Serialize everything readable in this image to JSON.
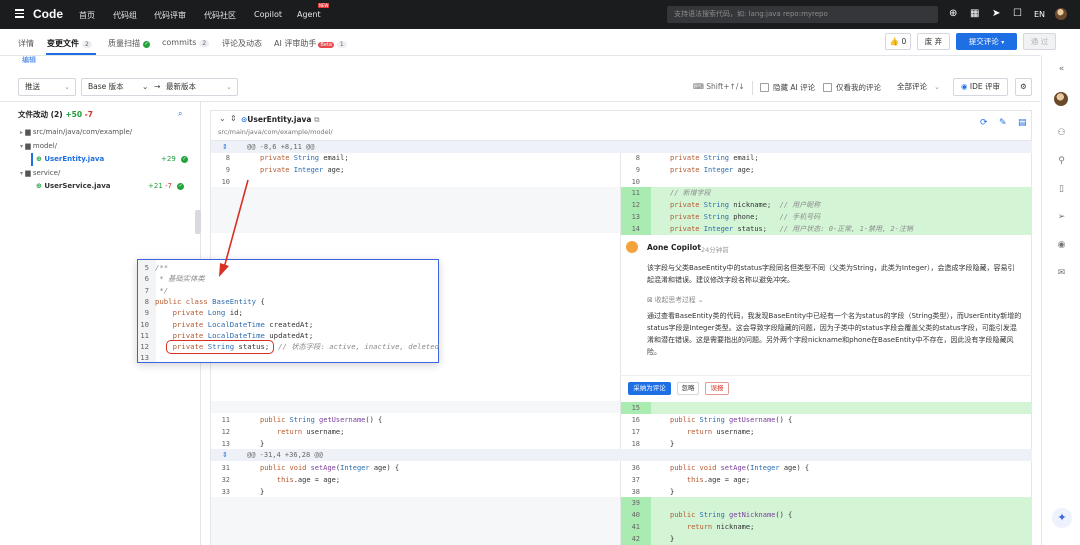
{
  "topbar": {
    "logo": "Code",
    "nav": [
      "首页",
      "代码组",
      "代码评审",
      "代码社区",
      "Copilot",
      "Agent"
    ],
    "new_badge": "NEW",
    "search_placeholder": "支持语法搜索代码，如: lang:java repo:myrepo",
    "lang": "EN"
  },
  "tabs": [
    {
      "label": "详情"
    },
    {
      "label": "变更文件",
      "count": "2"
    },
    {
      "label": "质量扫描"
    },
    {
      "label": "commits",
      "count": "2"
    },
    {
      "label": "评论及动态"
    },
    {
      "label": "AI 评审助手",
      "badge": "Beta",
      "count": "1"
    }
  ],
  "actions": {
    "like_count": "0",
    "abandon": "废 弃",
    "submit_review": "提交评论",
    "approve": "通 过"
  },
  "edit_link": "编辑",
  "toolbar": {
    "push_select": "推送",
    "base_select": "Base 版本",
    "arrow": "→",
    "latest_select": "最新版本",
    "shortcut_hint": "Shift+↑/↓",
    "hide_ai": "隐藏 AI 评论",
    "only_mine": "仅看我的评论",
    "all_comments": "全部评论",
    "ide_review": "IDE 评审"
  },
  "tree": {
    "title": "文件改动 (2)",
    "added": "+50",
    "removed": "-7",
    "path_root": "src/main/java/com/example/",
    "folder_model": "model/",
    "file1": {
      "name": "UserEntity.java",
      "added": "+29"
    },
    "folder_service": "service/",
    "file2": {
      "name": "UserService.java",
      "added": "+21",
      "removed": "-7"
    }
  },
  "diff": {
    "file_name": "UserEntity.java",
    "file_path": "src/main/java/com/example/model/",
    "hunk1": "@@ -8,6 +8,11 @@",
    "hunk2": "@@ -31,4 +36,28 @@",
    "left_rows": [
      {
        "ln": "8",
        "code": "private String email;"
      },
      {
        "ln": "9",
        "code": "private Integer age;"
      },
      {
        "ln": "10",
        "code": ""
      }
    ],
    "right_rows": [
      {
        "ln": "8",
        "code": "private String email;"
      },
      {
        "ln": "9",
        "code": "private Integer age;"
      },
      {
        "ln": "10",
        "code": ""
      },
      {
        "ln": "11",
        "code": "// 新增字段"
      },
      {
        "ln": "12",
        "code": "private String nickname;  // 用户昵称"
      },
      {
        "ln": "13",
        "code": "private String phone;     // 手机号码"
      },
      {
        "ln": "14",
        "code": "private Integer status;   // 用户状态: 0-正常, 1-禁用, 2-注销"
      }
    ],
    "block2_left": [
      {
        "ln": "11",
        "code": "public String getUsername() {"
      },
      {
        "ln": "12",
        "code": "    return username;"
      },
      {
        "ln": "13",
        "code": "}"
      }
    ],
    "block2_right": [
      {
        "ln": "15",
        "code": ""
      },
      {
        "ln": "16",
        "code": "public String getUsername() {"
      },
      {
        "ln": "17",
        "code": "    return username;"
      },
      {
        "ln": "18",
        "code": "}"
      }
    ],
    "block3_left": [
      {
        "ln": "31",
        "code": "public void setAge(Integer age) {"
      },
      {
        "ln": "32",
        "code": "    this.age = age;"
      },
      {
        "ln": "33",
        "code": "}"
      }
    ],
    "block3_right": [
      {
        "ln": "36",
        "code": "public void setAge(Integer age) {"
      },
      {
        "ln": "37",
        "code": "    this.age = age;"
      },
      {
        "ln": "38",
        "code": "}"
      },
      {
        "ln": "39",
        "code": ""
      },
      {
        "ln": "40",
        "code": "public String getNickname() {"
      },
      {
        "ln": "41",
        "code": "    return nickname;"
      },
      {
        "ln": "42",
        "code": "}"
      }
    ]
  },
  "comment": {
    "author": "Aone Copilot",
    "time": "24分钟前",
    "text": "该字段与父类BaseEntity中的status字段同名但类型不同（父类为String，此类为Integer），会造成字段隐藏，容易引起混淆和错误。建议修改字段名称以避免冲突。",
    "toggle": "收起思考过程",
    "thinking": "通过查看BaseEntity类的代码，我发现BaseEntity中已经有一个名为status的字段（String类型），而UserEntity新增的status字段是Integer类型。这会导致字段隐藏的问题，因为子类中的status字段会覆盖父类的status字段，可能引发混淆和潜在错误。这是需要指出的问题。另外两个字段nickname和phone在BaseEntity中不存在，因此没有字段隐藏风险。",
    "adopt": "采纳为评论",
    "ignore": "忽略",
    "dislike": "误报"
  },
  "popup": {
    "lines": [
      {
        "n": "5",
        "t": "/**"
      },
      {
        "n": "6",
        "t": " * 基础实体类"
      },
      {
        "n": "7",
        "t": " */"
      },
      {
        "n": "8",
        "t": "public class BaseEntity {"
      },
      {
        "n": "9",
        "t": "    private Long id;"
      },
      {
        "n": "10",
        "t": "    private LocalDateTime createdAt;"
      },
      {
        "n": "11",
        "t": "    private LocalDateTime updatedAt;"
      },
      {
        "n": "12",
        "t": "    private String status;  // 状态字段: active, inactive, deleted"
      },
      {
        "n": "13",
        "t": ""
      }
    ]
  },
  "colors": {
    "accent": "#1f6fe4",
    "added": "#d3f5d6",
    "highlight": "#d93025"
  }
}
